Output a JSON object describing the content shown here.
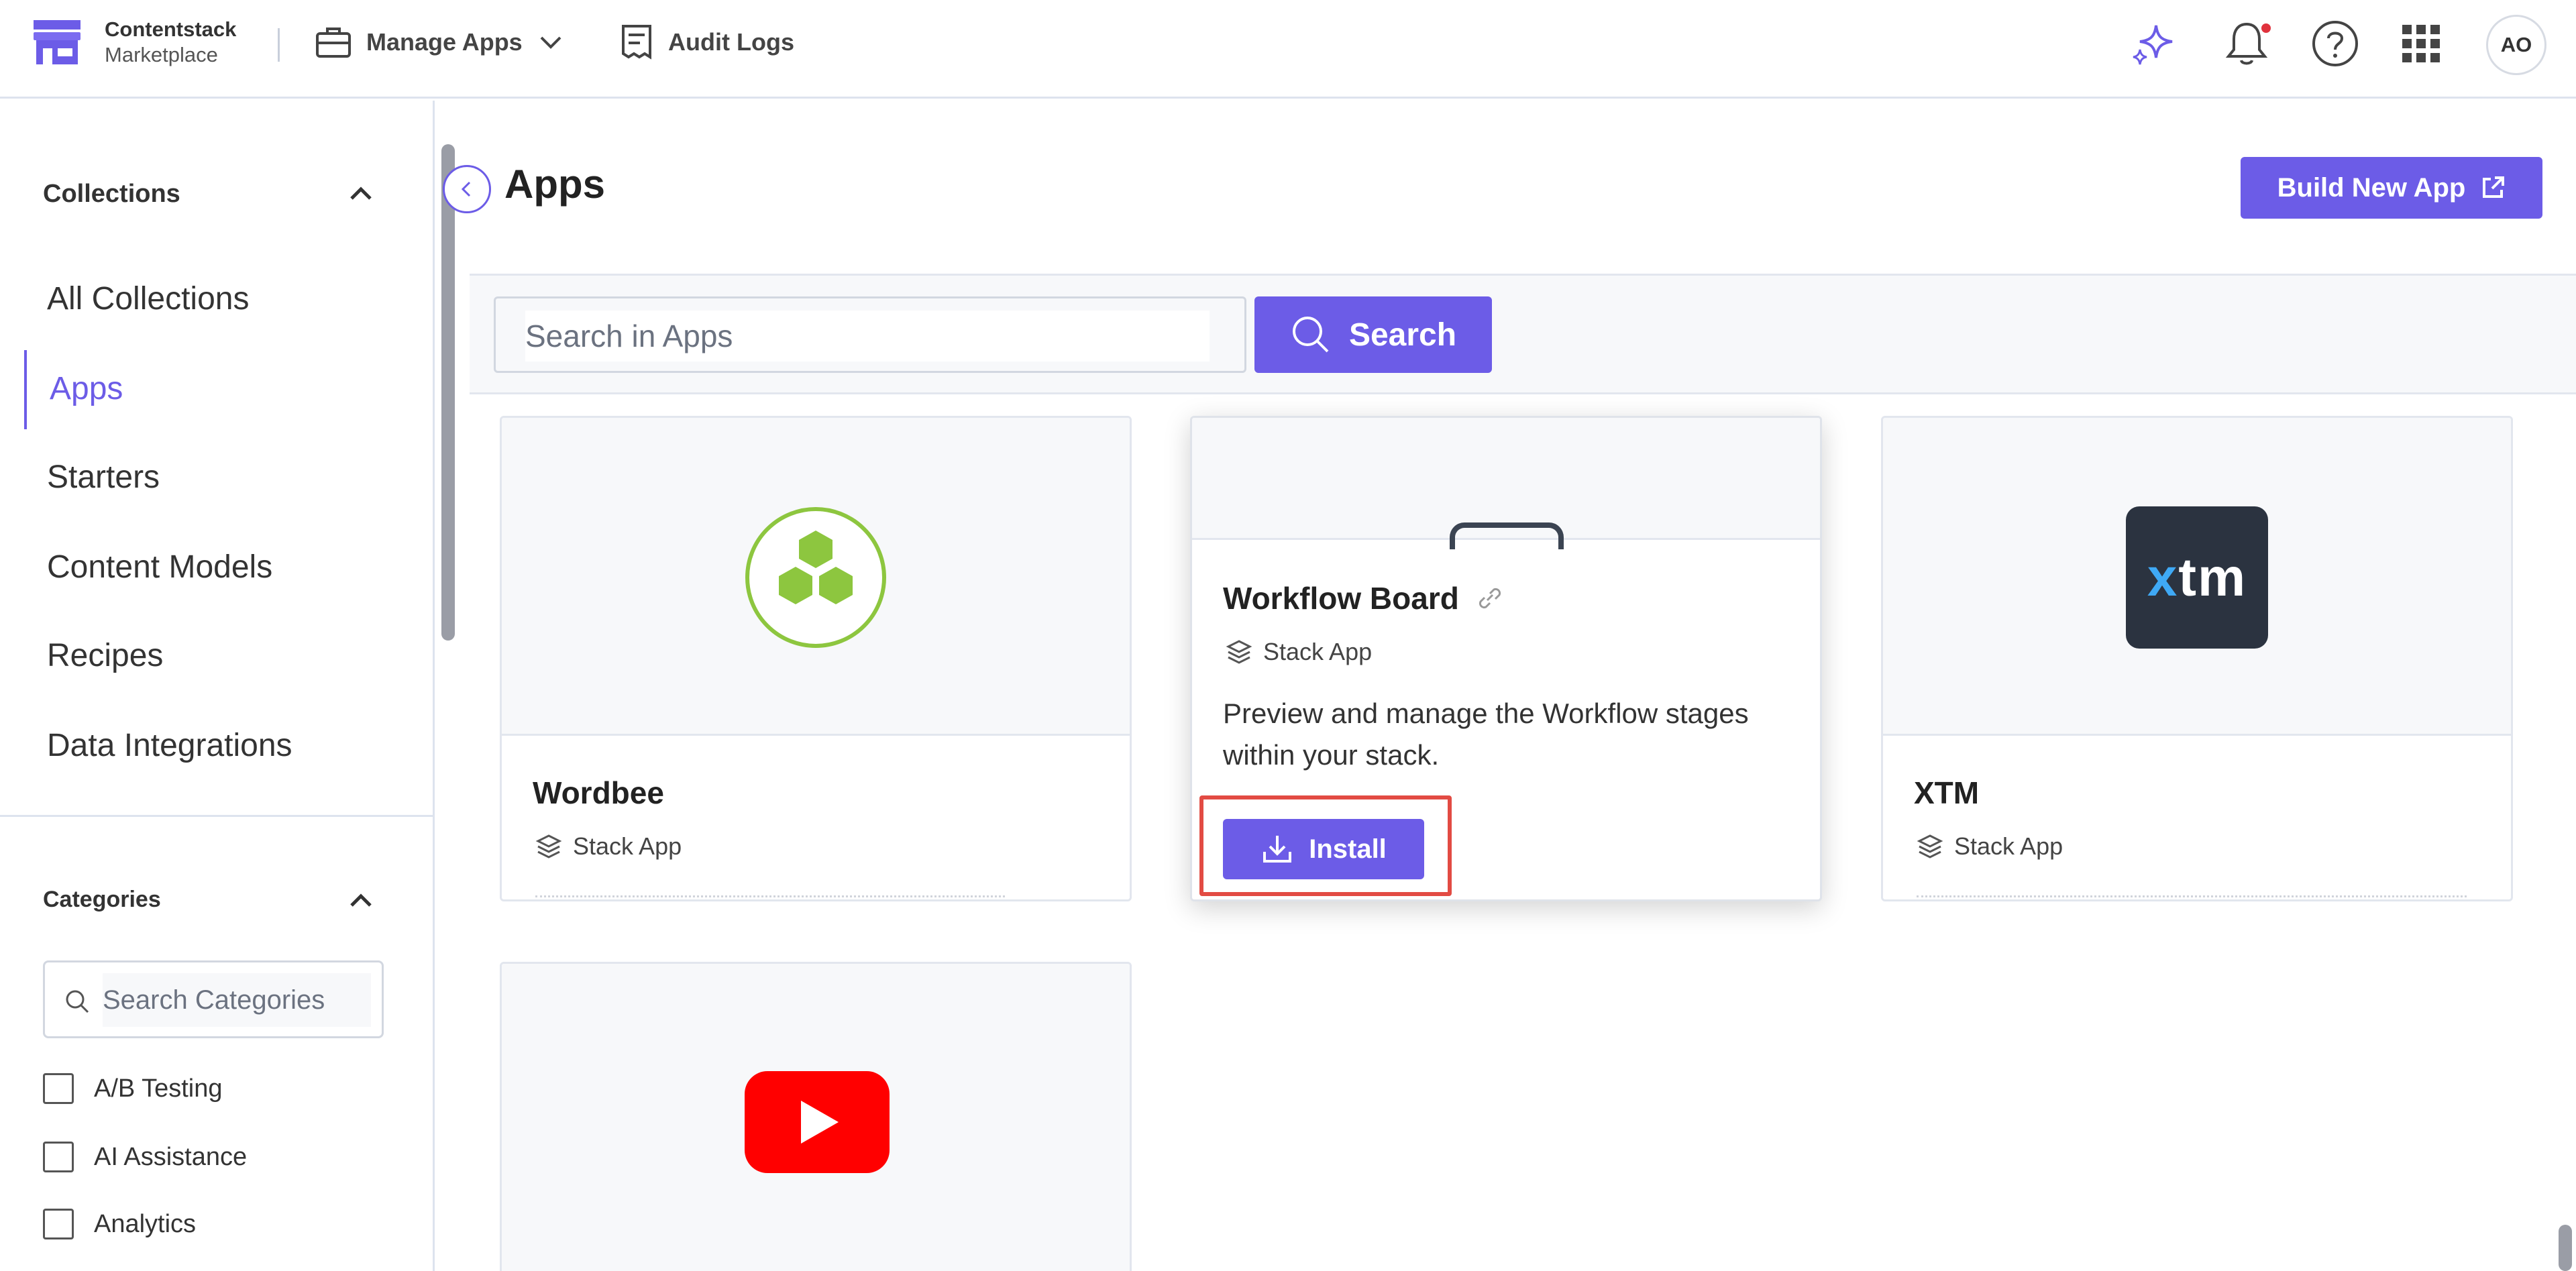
{
  "header": {
    "brand_title": "Contentstack",
    "brand_subtitle": "Marketplace",
    "nav": [
      {
        "label": "Manage Apps",
        "icon": "briefcase-icon"
      },
      {
        "label": "Audit Logs",
        "icon": "receipt-icon"
      }
    ],
    "icons": [
      "sparkle-icon",
      "bell-icon",
      "help-icon",
      "apps-grid-icon"
    ],
    "avatar_initials": "AO"
  },
  "sidebar": {
    "collections_heading": "Collections",
    "items": [
      {
        "label": "All Collections"
      },
      {
        "label": "Apps",
        "active": true
      },
      {
        "label": "Starters"
      },
      {
        "label": "Content Models"
      },
      {
        "label": "Recipes"
      },
      {
        "label": "Data Integrations"
      }
    ],
    "categories_heading": "Categories",
    "category_search_placeholder": "Search Categories",
    "categories": [
      "A/B Testing",
      "AI Assistance",
      "Analytics"
    ]
  },
  "main": {
    "title": "Apps",
    "build_button": "Build New App",
    "search_placeholder": "Search in Apps",
    "search_button": "Search",
    "cards": [
      {
        "name": "Wordbee",
        "type": "Stack App"
      },
      {
        "name": "Workflow Board",
        "type": "Stack App",
        "description": "Preview and manage the Workflow stages within your stack.",
        "install_label": "Install"
      },
      {
        "name": "XTM",
        "type": "Stack App",
        "logo_text": "XTM"
      },
      {
        "name": "YouTube"
      }
    ]
  },
  "colors": {
    "accent": "#6c5ce7",
    "highlight": "#e24b43",
    "wordbee_green": "#8dc63f",
    "xtm_bg": "#2b3340",
    "youtube_red": "#ff0000"
  }
}
